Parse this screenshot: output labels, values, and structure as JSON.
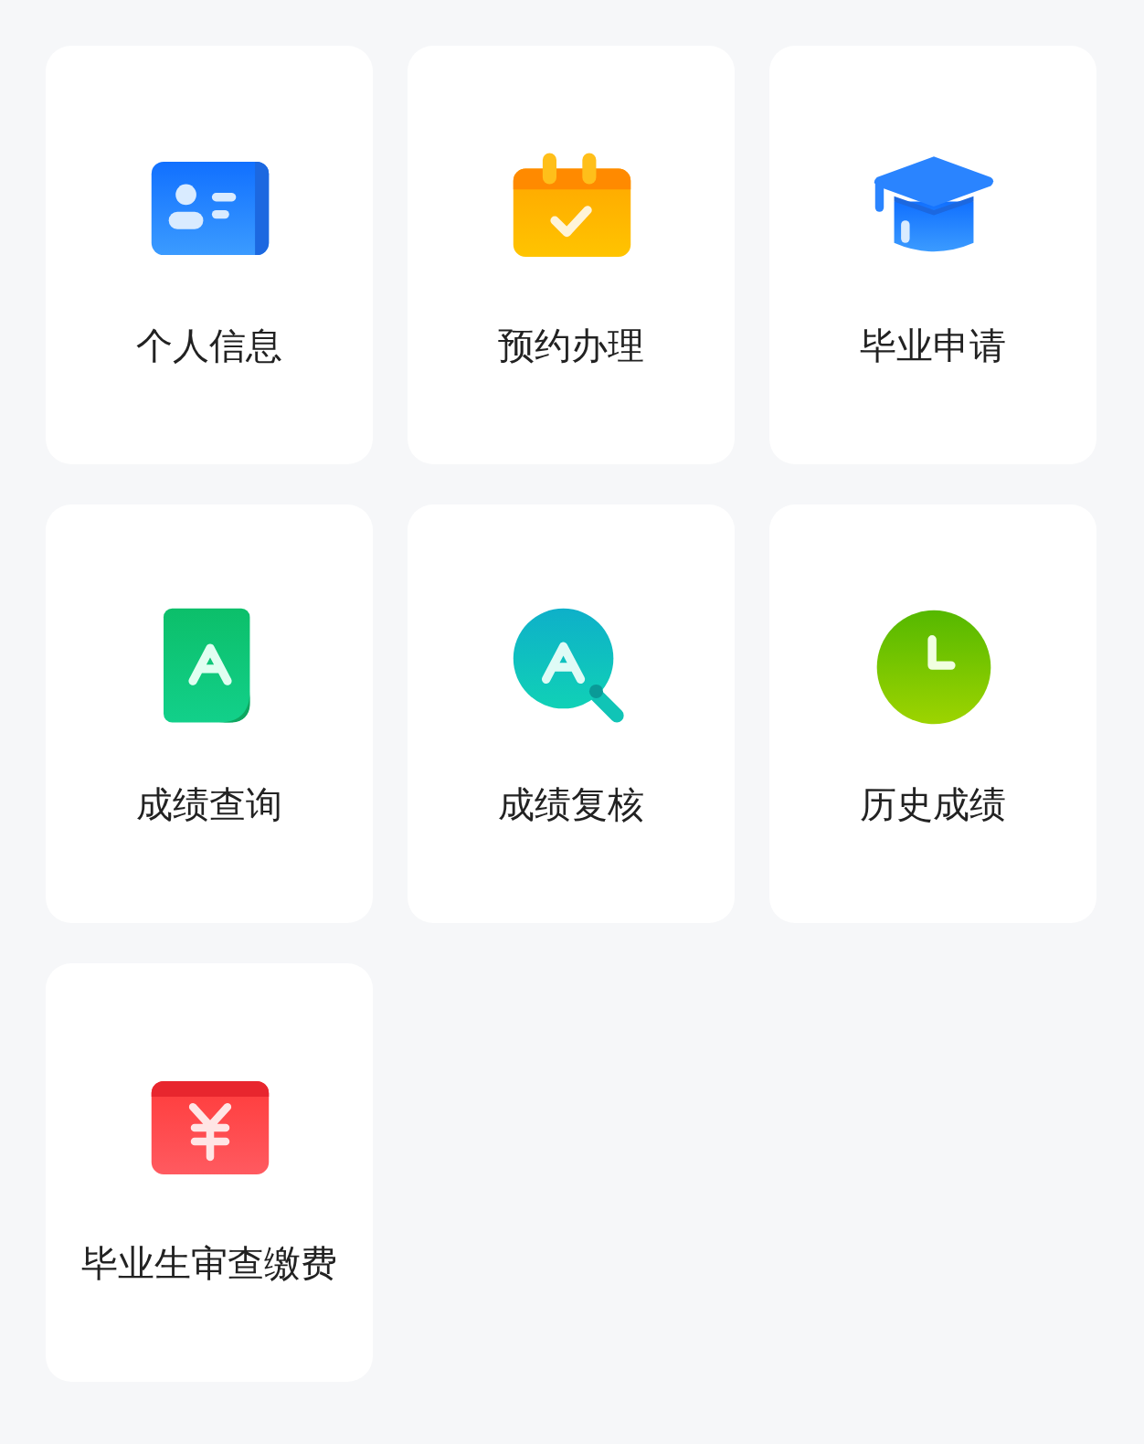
{
  "tiles": [
    {
      "label": "个人信息"
    },
    {
      "label": "预约办理"
    },
    {
      "label": "毕业申请"
    },
    {
      "label": "成绩查询"
    },
    {
      "label": "成绩复核"
    },
    {
      "label": "历史成绩"
    },
    {
      "label": "毕业生审查缴费"
    }
  ]
}
